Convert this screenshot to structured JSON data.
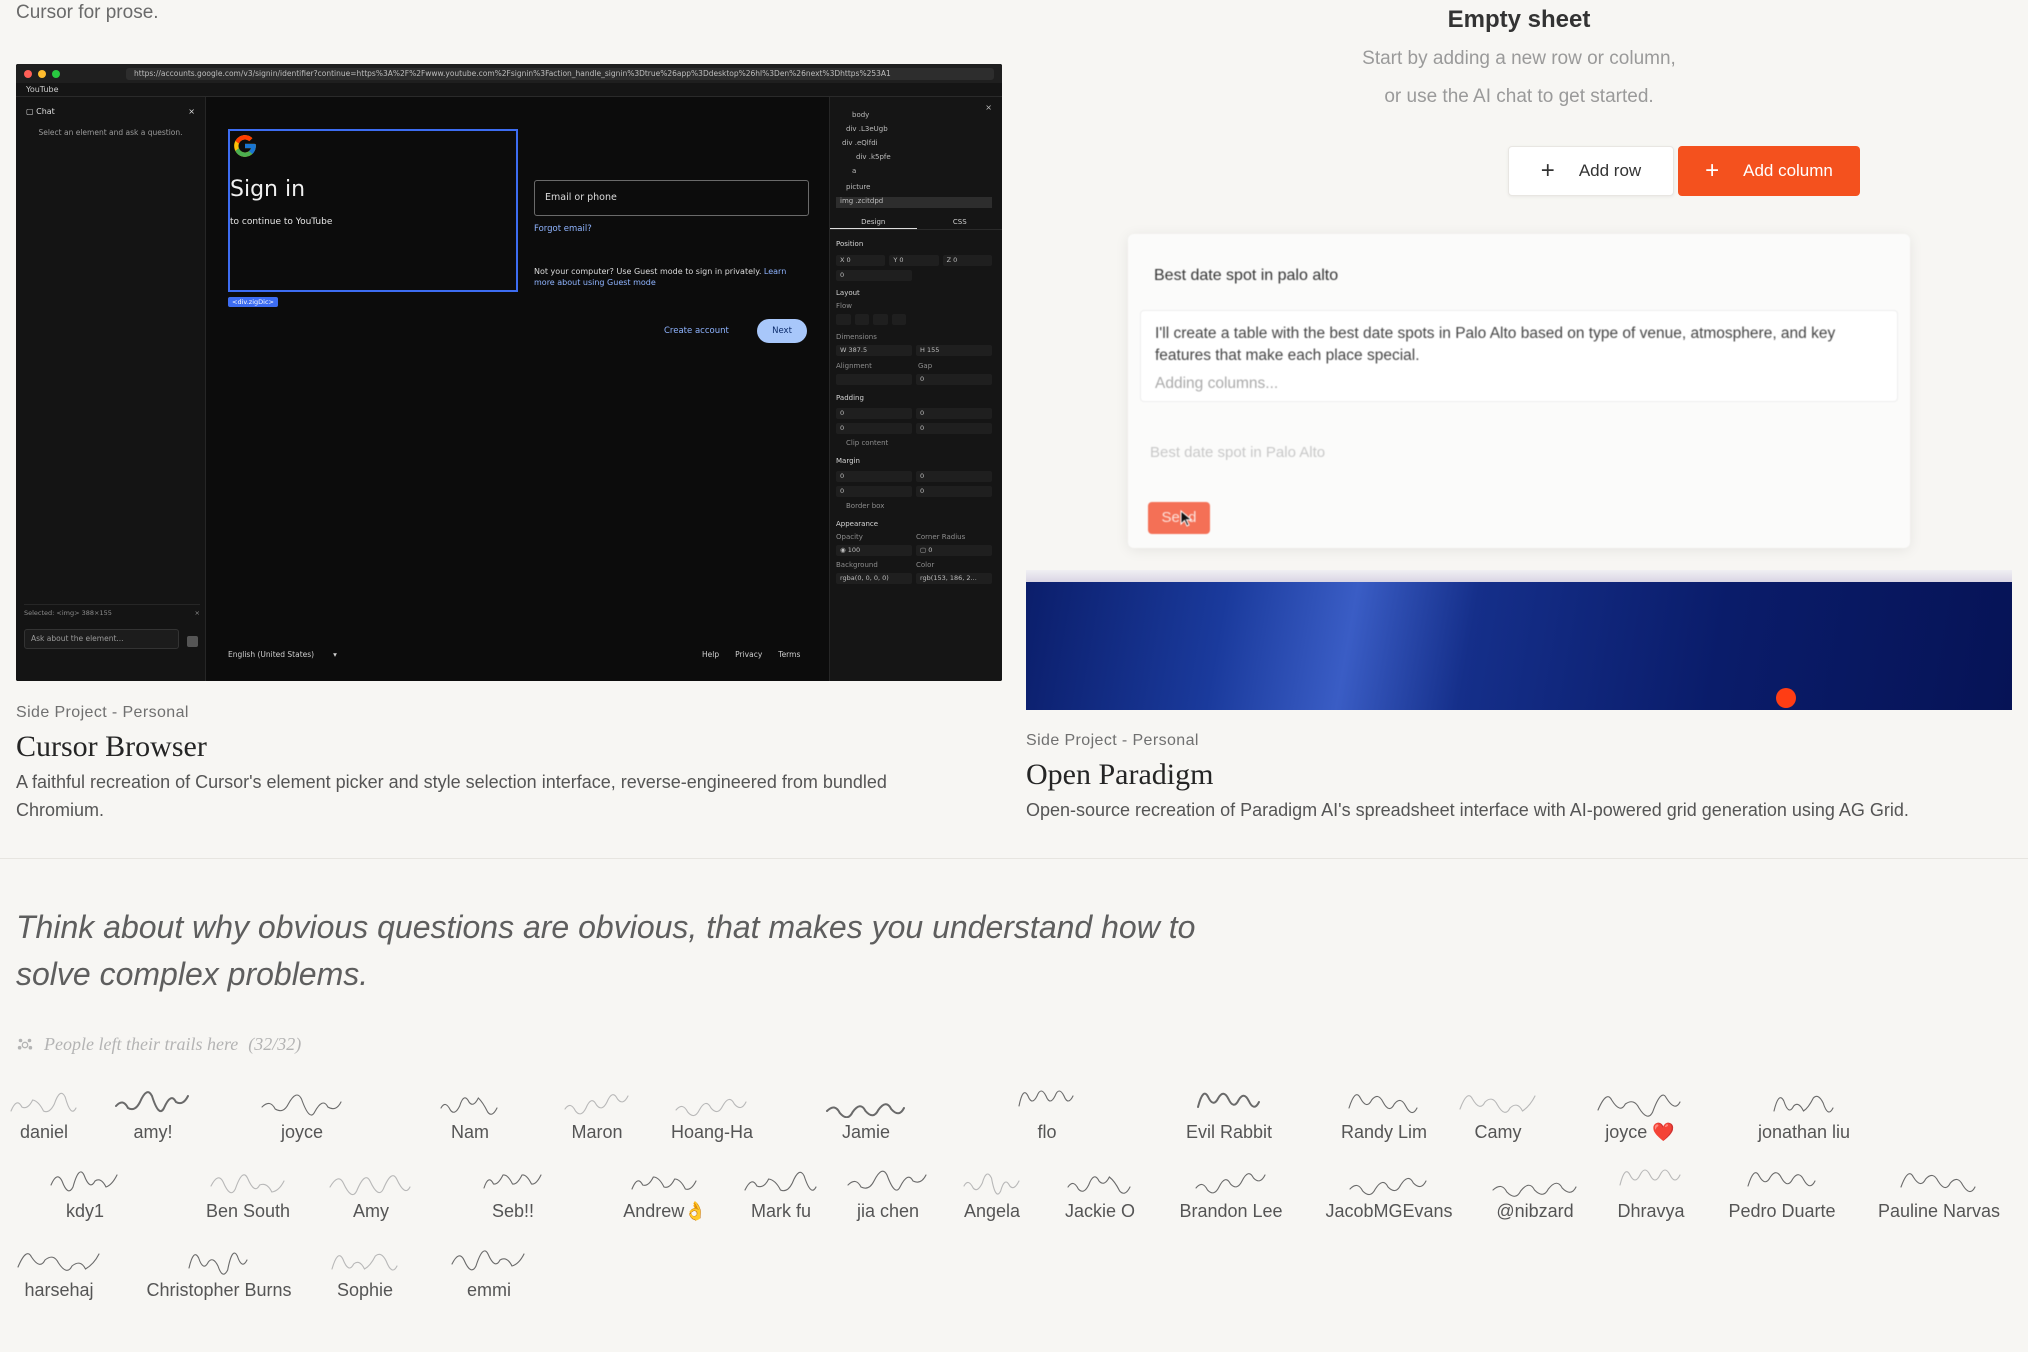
{
  "top_tag": "Cursor for prose.",
  "cursor_browser": {
    "url": "https://accounts.google.com/v3/signin/identifier?continue=https%3A%2F%2Fwww.youtube.com%2Fsignin%3Faction_handle_signin%3Dtrue%26app%3Ddesktop%26hl%3Den%26next%3Dhttps%253A1",
    "tab": "YouTube",
    "chat_title": "Chat",
    "chat_hint": "Select an element and ask a question.",
    "selected": "Selected: <img> 388×155",
    "chat_placeholder": "Ask about the element...",
    "signin_title": "Sign in",
    "signin_sub": "to continue to YouTube",
    "selection_tag": "<div.zigDic>",
    "email_placeholder": "Email or phone",
    "forgot": "Forgot email?",
    "guest_text": "Not your computer? Use Guest mode to sign in privately.",
    "guest_link": "Learn more about using Guest mode",
    "create_account": "Create account",
    "next": "Next",
    "language": "English (United States)",
    "footer_links": [
      "Help",
      "Privacy",
      "Terms"
    ],
    "inspector": {
      "tree": [
        "body",
        "div .L3eUgb",
        "div .eQlfdi",
        "div .k5pfe",
        "a",
        "picture",
        "img .zcitdpd"
      ],
      "tabs": [
        "Design",
        "CSS"
      ],
      "sections": [
        "Position",
        "Layout",
        "Flow",
        "Dimensions",
        "Alignment",
        "Gap",
        "Padding",
        "Clip content",
        "Margin",
        "Border box",
        "Appearance",
        "Opacity",
        "Corner Radius",
        "Background",
        "Color"
      ],
      "width": "387.5",
      "height": "155",
      "opacity": "100",
      "bg_value": "rgba(0, 0, 0, 0)",
      "color_value": "rgb(153, 186, 2..."
    }
  },
  "open_paradigm": {
    "sheet_title": "Empty sheet",
    "sheet_sub1": "Start by adding a new row or column,",
    "sheet_sub2": "or use the AI chat to get started.",
    "add_row": "Add row",
    "add_column": "Add column",
    "question": "Best date spot in palo alto",
    "answer": "I'll create a table with the best date spots in Palo Alto based on type of venue, atmosphere, and key features that make each place special.",
    "adding": "Adding columns...",
    "prompt_placeholder": "Best date spot in Palo Alto",
    "send": "Send"
  },
  "projects": [
    {
      "tag": "Side Project - Personal",
      "title": "Cursor Browser",
      "desc": "A faithful recreation of Cursor's element picker and style selection interface, reverse-engineered from bundled Chromium."
    },
    {
      "tag": "Side Project - Personal",
      "title": "Open Paradigm",
      "desc": "Open-source recreation of Paradigm AI's spreadsheet interface with AI-powered grid generation using AG Grid."
    }
  ],
  "quote": "Think about why obvious questions are obvious, that makes you understand how to solve complex problems.",
  "trails": {
    "label": "People left their trails here",
    "count": "(32/32)",
    "names": [
      "daniel",
      "amy!",
      "joyce",
      "Nam",
      "Maron",
      "Hoang-Ha",
      "Jamie",
      "flo",
      "Evil Rabbit",
      "Randy Lim",
      "Camy",
      "joyce ❤️",
      "jonathan liu",
      "kdy1",
      "Ben South",
      "Amy",
      "Seb!!",
      "Andrew👌",
      "Mark fu",
      "jia chen",
      "Angela",
      "Jackie O",
      "Brandon Lee",
      "JacobMGEvans",
      "@nibzard",
      "Dhravya",
      "Pedro Duarte",
      "Pauline Narvas",
      "harsehaj",
      "Christopher Burns",
      "Sophie",
      "emmi"
    ]
  },
  "colors": {
    "accent_orange": "#f4511e",
    "select_blue": "#3d6df2",
    "bg": "#f7f6f3"
  }
}
